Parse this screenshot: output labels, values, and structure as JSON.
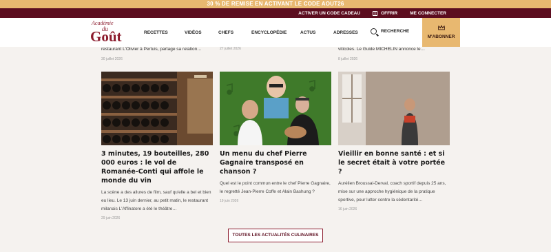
{
  "promo_banner": "30 % DE REMISE EN ACTIVANT LE CODE AOUT26",
  "topbar": {
    "gift_code": "ACTIVER UN CODE CADEAU",
    "offer": "OFFRIR",
    "login": "ME CONNECTER"
  },
  "logo": {
    "line1": "Académie",
    "line2": "du",
    "line3": "Goût"
  },
  "nav": {
    "items": [
      "RECETTES",
      "VIDÉOS",
      "CHEFS",
      "ENCYCLOPÉDIE",
      "ACTUS",
      "ADRESSES"
    ],
    "search": "RECHERCHE",
    "subscribe": "M'ABONNER"
  },
  "previous_row": [
    {
      "text": "restaurant L'Olivier à Pertuis, partage sa relation…",
      "date": "30 juillet 2026"
    },
    {
      "text": "",
      "date": "27 juillet 2026"
    },
    {
      "text": "viticoles. Le Guide MICHELIN annonce le…",
      "date": "8 juillet 2026"
    }
  ],
  "articles": [
    {
      "title": "3 minutes, 19 bouteilles, 280 000 euros : le vol de Romanée-Conti qui affole le monde du vin",
      "excerpt": "La scène a des allures de film, sauf qu'elle a bel et bien eu lieu. Le 13 juin dernier, au petit matin, le restaurant milanais L'Affinatore a été le théâtre…",
      "date": "29 juin 2026"
    },
    {
      "title": "Un menu du chef Pierre Gagnaire transposé en chanson ?",
      "excerpt": "Quel est le point commun entre le chef Pierre Gagnaire, le regretté Jean-Pierre Coffe et Alain Bashung ?",
      "date": "19 juin 2026"
    },
    {
      "title": "Vieillir en bonne santé : et si le secret était à votre portée ?",
      "excerpt": "Aurélien Broussal-Derval, coach sportif depuis 25 ans, mise sur une approche hygiénique de la pratique sportive, pour lutter contre la sédentarité…",
      "date": "16 juin 2026"
    }
  ],
  "cta": "TOUTES LES ACTUALITÉS CULINAIRES",
  "colors": {
    "burgundy": "#5c0d1f",
    "gold": "#e8b870",
    "background": "#f5f2ef"
  }
}
